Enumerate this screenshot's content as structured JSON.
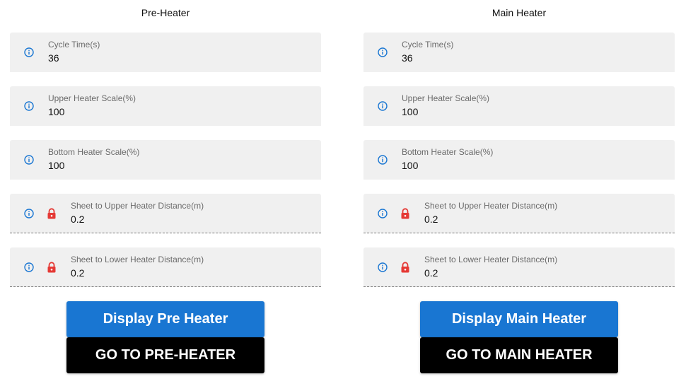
{
  "colors": {
    "primary": "#1976d2",
    "info_icon": "#1976d2",
    "lock_icon": "#e53935",
    "field_bg": "#f0f0f0",
    "goto_bg": "#000000"
  },
  "icons": {
    "info": "info-circle-icon",
    "lock": "lock-icon"
  },
  "pre_heater": {
    "title": "Pre-Heater",
    "fields": [
      {
        "label": "Cycle Time(s)",
        "value": "36"
      },
      {
        "label": "Upper Heater Scale(%)",
        "value": "100"
      },
      {
        "label": "Bottom Heater Scale(%)",
        "value": "100"
      },
      {
        "label": "Sheet to Upper Heater Distance(m)",
        "value": "0.2"
      },
      {
        "label": "Sheet to Lower Heater Distance(m)",
        "value": "0.2"
      }
    ],
    "display_button": "Display Pre Heater",
    "goto_button": "GO TO PRE-HEATER"
  },
  "main_heater": {
    "title": "Main Heater",
    "fields": [
      {
        "label": "Cycle Time(s)",
        "value": "36"
      },
      {
        "label": "Upper Heater Scale(%)",
        "value": "100"
      },
      {
        "label": "Bottom Heater Scale(%)",
        "value": "100"
      },
      {
        "label": "Sheet to Upper Heater Distance(m)",
        "value": "0.2"
      },
      {
        "label": "Sheet to Lower Heater Distance(m)",
        "value": "0.2"
      }
    ],
    "display_button": "Display Main Heater",
    "goto_button": "GO TO MAIN HEATER"
  }
}
